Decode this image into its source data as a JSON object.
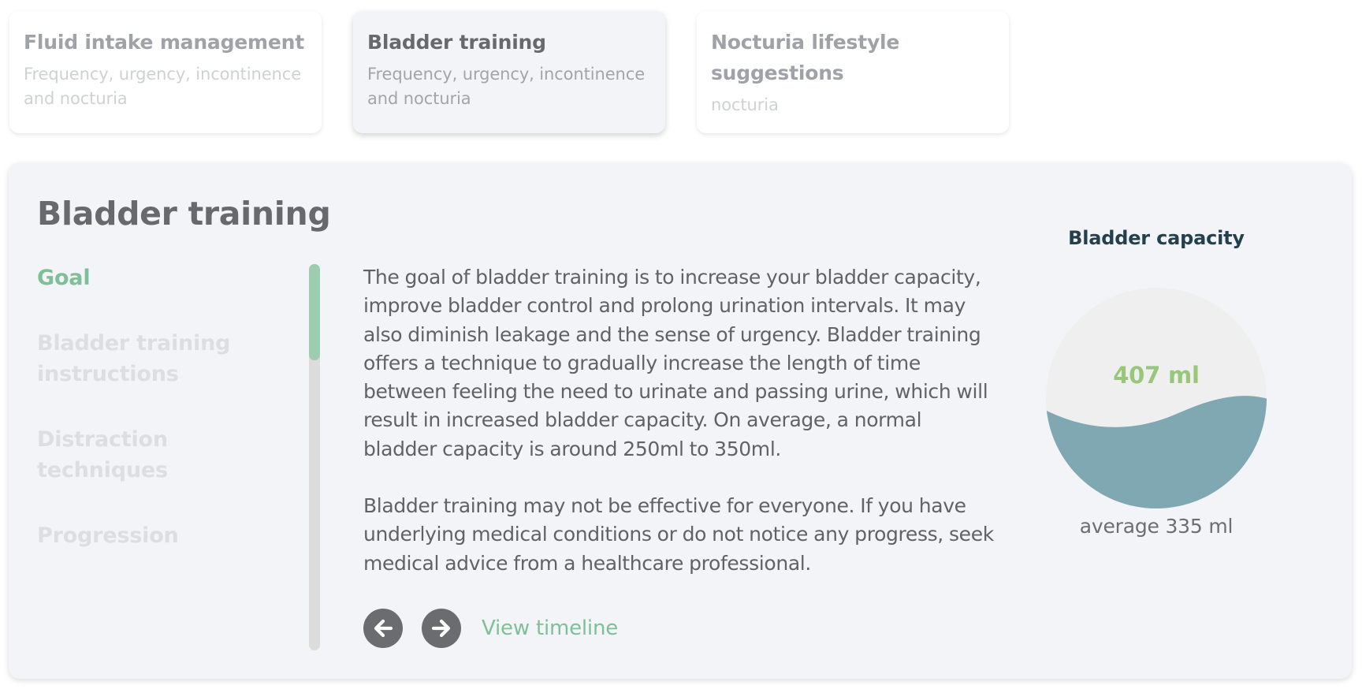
{
  "cards": [
    {
      "title": "Fluid intake management",
      "subtitle": "Frequency, urgency, incontinence and nocturia"
    },
    {
      "title": "Bladder training",
      "subtitle": "Frequency, urgency, incontinence and nocturia"
    },
    {
      "title": "Nocturia lifestyle suggestions",
      "subtitle": "nocturia"
    }
  ],
  "active_card_index": 1,
  "panel": {
    "title": "Bladder training",
    "nav": [
      {
        "label": "Goal",
        "active": true
      },
      {
        "label": "Bladder training instructions",
        "active": false
      },
      {
        "label": "Distraction techniques",
        "active": false
      },
      {
        "label": "Progression",
        "active": false
      }
    ],
    "paragraphs": [
      "The goal of bladder training is to increase your bladder capacity, improve bladder control and prolong urination intervals. It may also diminish leakage and the sense of urgency. Bladder training offers a technique to gradually increase the length of time between feeling the need to urinate and passing urine, which will result in increased bladder capacity. On average, a normal bladder capacity is around 250ml to 350ml.",
      "Bladder training may not be effective for everyone. If you have underlying medical conditions or do not notice any progress, seek medical advice from a healthcare professional."
    ],
    "controls": {
      "prev_icon": "arrow-left-circle-icon",
      "next_icon": "arrow-right-circle-icon",
      "timeline_label": "View timeline"
    }
  },
  "capacity": {
    "title": "Bladder capacity",
    "value_label": "407 ml",
    "average_label": "average 335 ml",
    "fill_fraction": 0.45
  },
  "colors": {
    "accent_green": "#7fbf98",
    "value_green": "#98c67a",
    "water": "#7fa8b2",
    "gauge_background": "#efefef",
    "button_dark": "#6b6c6f"
  }
}
